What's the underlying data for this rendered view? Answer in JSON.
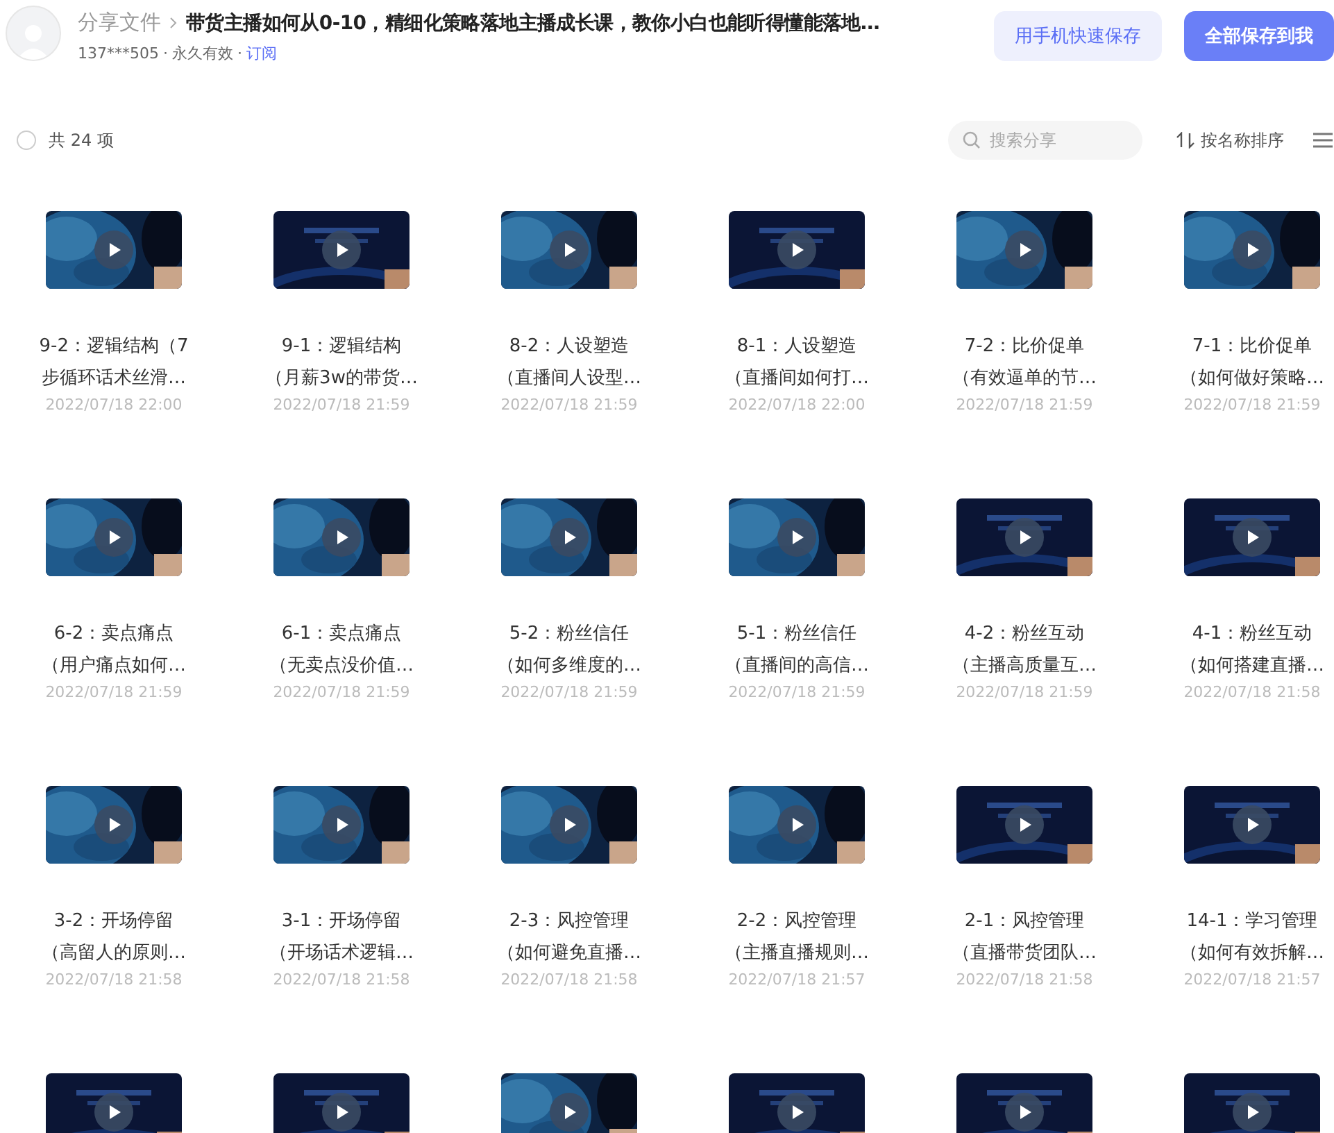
{
  "header": {
    "breadcrumb": "分享文件",
    "title": "带货主播如何从0-10，精细化策略落地主播成长课，教你小白也能听得懂能落地…",
    "owner": "137***505",
    "validity": "永久有效",
    "subscribe": "订阅",
    "separator": "·",
    "buttons": [
      {
        "label": "用手机快速保存",
        "kind": "secondary"
      },
      {
        "label": "全部保存到我",
        "kind": "primary"
      }
    ]
  },
  "toolbar": {
    "select_all": {
      "checked": false
    },
    "count": "共 24 项",
    "search": {
      "placeholder": "搜索分享"
    },
    "sort": "按名称排序"
  },
  "files": [
    {
      "kind": "video",
      "lines": [
        "9-2：逻辑结构（7",
        "步循环话术丝滑…"
      ],
      "date": "2022/07/18 22:00"
    },
    {
      "kind": "video",
      "lines": [
        "9-1：逻辑结构",
        "（月薪3w的带货…"
      ],
      "date": "2022/07/18 21:59"
    },
    {
      "kind": "video",
      "lines": [
        "8-2：人设塑造",
        "（直播间人设型…"
      ],
      "date": "2022/07/18 21:59"
    },
    {
      "kind": "video",
      "lines": [
        "8-1：人设塑造",
        "（直播间如何打…"
      ],
      "date": "2022/07/18 22:00"
    },
    {
      "kind": "video",
      "lines": [
        "7-2：比价促单",
        "（有效逼单的节…"
      ],
      "date": "2022/07/18 21:59"
    },
    {
      "kind": "video",
      "lines": [
        "7-1：比价促单",
        "（如何做好策略…"
      ],
      "date": "2022/07/18 21:59"
    },
    {
      "kind": "video",
      "lines": [
        "6-2：卖点痛点",
        "（用户痛点如何…"
      ],
      "date": "2022/07/18 21:59"
    },
    {
      "kind": "video",
      "lines": [
        "6-1：卖点痛点",
        "（无卖点没价值…"
      ],
      "date": "2022/07/18 21:59"
    },
    {
      "kind": "video",
      "lines": [
        "5-2：粉丝信任",
        "（如何多维度的…"
      ],
      "date": "2022/07/18 21:59"
    },
    {
      "kind": "video",
      "lines": [
        "5-1：粉丝信任",
        "（直播间的高信…"
      ],
      "date": "2022/07/18 21:59"
    },
    {
      "kind": "video",
      "lines": [
        "4-2：粉丝互动",
        "（主播高质量互…"
      ],
      "date": "2022/07/18 21:59"
    },
    {
      "kind": "video",
      "lines": [
        "4-1：粉丝互动",
        "（如何搭建直播…"
      ],
      "date": "2022/07/18 21:58"
    },
    {
      "kind": "video",
      "lines": [
        "3-2：开场停留",
        "（高留人的原则…"
      ],
      "date": "2022/07/18 21:58"
    },
    {
      "kind": "video",
      "lines": [
        "3-1：开场停留",
        "（开场话术逻辑…"
      ],
      "date": "2022/07/18 21:58"
    },
    {
      "kind": "video",
      "lines": [
        "2-3：风控管理",
        "（如何避免直播…"
      ],
      "date": "2022/07/18 21:58"
    },
    {
      "kind": "video",
      "lines": [
        "2-2：风控管理",
        "（主播直播规则…"
      ],
      "date": "2022/07/18 21:57"
    },
    {
      "kind": "video",
      "lines": [
        "2-1：风控管理",
        "（直播带货团队…"
      ],
      "date": "2022/07/18 21:58"
    },
    {
      "kind": "video",
      "lines": [
        "14-1：学习管理",
        "（如何有效拆解…"
      ],
      "date": "2022/07/18 21:57"
    },
    {
      "kind": "video"
    },
    {
      "kind": "video"
    },
    {
      "kind": "video"
    },
    {
      "kind": "video"
    },
    {
      "kind": "video"
    },
    {
      "kind": "video"
    }
  ]
}
